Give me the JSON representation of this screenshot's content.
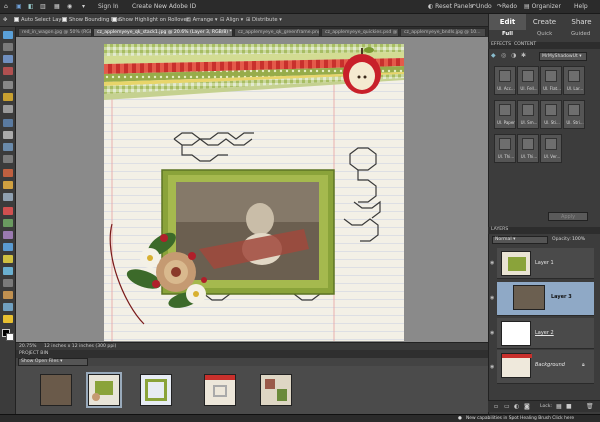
{
  "menubar": {
    "home": "⌂",
    "sign_in": "Sign In",
    "create_id": "Create New Adobe ID",
    "reset_panels": "Reset Panels",
    "undo": "Undo",
    "redo": "Redo",
    "organizer": "Organizer",
    "help": "Help"
  },
  "options": {
    "auto_select": "Auto Select Layer",
    "bounding_box": "Show Bounding Box",
    "highlight": "Show Highlight on Rollover",
    "arrange": "Arrange",
    "align": "Align",
    "distribute": "Distribute"
  },
  "tabs": [
    {
      "label": "red_in_wagon.jpg @ 50% (RGB/...",
      "active": false
    },
    {
      "label": "cz_applemyeye_qk_stack1.jpg @ 20.6% (Layer 3, RGB/8) *",
      "active": true
    },
    {
      "label": "cz_applemyeye_qk_greenframe.png",
      "active": false
    },
    {
      "label": "cz_applemyeye_quickies.psd @ ...",
      "active": false
    },
    {
      "label": "cz_applemyeye_bndls.jpg @ 10...",
      "active": false
    }
  ],
  "modes": [
    "Edit",
    "Create",
    "Share"
  ],
  "submodes": [
    "Full",
    "Quick",
    "Guided"
  ],
  "panels": {
    "effects_tabs": [
      "EFFECTS",
      "CONTENT"
    ],
    "effects_dropdown": "MrMyShadowUt",
    "effects": [
      "Ul. Acc...",
      "Ul. Fell...",
      "Ul. Flat...",
      "Ul. Lar...",
      "Ul. Paper",
      "Ul. Sm...",
      "Ul. Sti...",
      "Ul. Stri...",
      "Ul. Thi...",
      "Ul. Thi...",
      "Ul. Ver..."
    ],
    "apply": "Apply",
    "layers_title": "LAYERS",
    "blend_mode": "Normal",
    "opacity_label": "Opacity:",
    "opacity_value": "100%",
    "layers": [
      {
        "name": "Layer 1",
        "selected": false
      },
      {
        "name": "Layer 3",
        "selected": true
      },
      {
        "name": "Layer 2",
        "selected": false
      },
      {
        "name": "Background",
        "selected": false
      }
    ],
    "lock_label": "Lock:"
  },
  "status": {
    "zoom": "20.75%",
    "doc_size": "12 inches x 12 inches (300 ppi)"
  },
  "bin": {
    "title": "PROJECT BIN",
    "dropdown": "Show Open Files"
  },
  "bottombar": {
    "tip": "New capabilities in Spot Healing Brush Click here"
  },
  "colors": {
    "accent": "#8fa9c6",
    "frame_green": "#8aa33a",
    "apple_red": "#c8202a"
  }
}
